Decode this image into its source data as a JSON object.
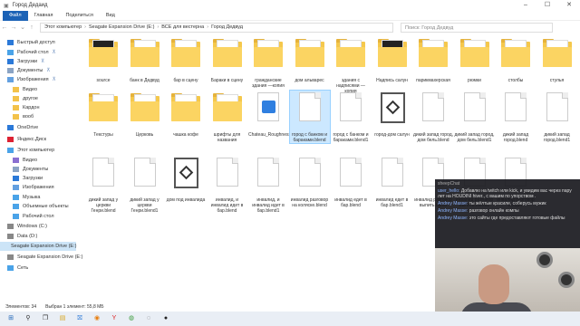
{
  "window": {
    "title": "Город Дедаид",
    "controls": [
      "–",
      "☐",
      "✕"
    ]
  },
  "ribbon": {
    "tabs": [
      "Файл",
      "Главная",
      "Поделиться",
      "Вид"
    ]
  },
  "address": {
    "crumbs": [
      "Этот компьютер",
      "Seagate Expansion Drive (E:)",
      "ВСЕ для вестерна",
      "Город Дедвуд"
    ],
    "search_placeholder": "Поиск: Город Дедвуд"
  },
  "sidebar": {
    "items": [
      {
        "label": "Быстрый доступ",
        "icon": "star-icon",
        "color": "#2b79d8"
      },
      {
        "label": "Рабочий стол",
        "icon": "desktop-icon",
        "color": "#4aa3e8",
        "pinned": true
      },
      {
        "label": "Загрузки",
        "icon": "download-icon",
        "color": "#2b79d8",
        "pinned": true
      },
      {
        "label": "Документы",
        "icon": "documents-icon",
        "color": "#8ba4c4",
        "pinned": true
      },
      {
        "label": "Изображения",
        "icon": "images-icon",
        "color": "#63a0e0",
        "pinned": true
      },
      {
        "label": "Видео",
        "icon": "folder-icon",
        "color": "#f3c24a"
      },
      {
        "label": "другое",
        "icon": "folder-icon",
        "color": "#f3c24a"
      },
      {
        "label": "Кардон",
        "icon": "folder-icon",
        "color": "#f3c24a"
      },
      {
        "label": "вооб",
        "icon": "folder-icon",
        "color": "#f3c24a"
      },
      {
        "label": "OneDrive",
        "icon": "cloud-icon",
        "color": "#2b79d8"
      },
      {
        "label": "Яндекс.Диск",
        "icon": "yandex-disk-icon",
        "color": "#d23"
      },
      {
        "label": "Этот компьютер",
        "icon": "computer-icon",
        "color": "#4aa3e8"
      },
      {
        "label": "Видео",
        "icon": "video-icon",
        "color": "#8a6fd1"
      },
      {
        "label": "Документы",
        "icon": "documents-icon",
        "color": "#8ba4c4"
      },
      {
        "label": "Загрузки",
        "icon": "download-icon",
        "color": "#2b79d8"
      },
      {
        "label": "Изображения",
        "icon": "images-icon",
        "color": "#63a0e0"
      },
      {
        "label": "Музыка",
        "icon": "music-icon",
        "color": "#4aa3e8"
      },
      {
        "label": "Объемные объекты",
        "icon": "3d-objects-icon",
        "color": "#4aa3e8"
      },
      {
        "label": "Рабочий стол",
        "icon": "desktop-icon",
        "color": "#4aa3e8"
      },
      {
        "label": "Windows (C:)",
        "icon": "drive-icon",
        "color": "#888"
      },
      {
        "label": "Data (D:)",
        "icon": "drive-icon",
        "color": "#888"
      },
      {
        "label": "Seagate Expansion Drive (E:)",
        "icon": "drive-icon",
        "color": "#888",
        "selected": true
      },
      {
        "label": "Seagate Expansion Drive (E:)",
        "icon": "drive-icon",
        "color": "#888"
      },
      {
        "label": "Сеть",
        "icon": "network-icon",
        "color": "#4aa3e8"
      }
    ]
  },
  "files": {
    "row1": [
      {
        "label": "source",
        "type": "folder-dark"
      },
      {
        "label": "банк в Дедвуд",
        "type": "folder"
      },
      {
        "label": "бар в сцену",
        "type": "folder"
      },
      {
        "label": "Бараки в сцену",
        "type": "folder"
      },
      {
        "label": "гражданские здания —копия",
        "type": "folder"
      },
      {
        "label": "дом альварес",
        "type": "folder"
      },
      {
        "label": "здания с надписями —копия",
        "type": "folder"
      },
      {
        "label": "Надпись салун",
        "type": "folder-dark"
      },
      {
        "label": "парикмахерская",
        "type": "folder"
      },
      {
        "label": "рюмки",
        "type": "folder"
      },
      {
        "label": "столбы",
        "type": "folder"
      },
      {
        "label": "стулья",
        "type": "folder"
      }
    ],
    "row2": [
      {
        "label": "Текстуры",
        "type": "folder"
      },
      {
        "label": "Церковь",
        "type": "folder"
      },
      {
        "label": "чашка кофе",
        "type": "folder"
      },
      {
        "label": "шрифты для названия",
        "type": "folder"
      },
      {
        "label": "Chateau_Roughness",
        "type": "image"
      },
      {
        "label": "город с банком и бараками.blend",
        "type": "doc",
        "selected": true
      },
      {
        "label": "город с банком и бараками.blend1",
        "type": "doc"
      },
      {
        "label": "город-дом салун",
        "type": "blend"
      },
      {
        "label": "дикий запад город, дом бель.blend",
        "type": "doc"
      },
      {
        "label": "дикий запад город, дом бель.blend1",
        "type": "doc"
      },
      {
        "label": "дикий запад город.blend",
        "type": "doc"
      },
      {
        "label": "дикий запад город.blend1",
        "type": "doc"
      }
    ],
    "row3": [
      {
        "label": "дикий запад у церкви Генри.blend",
        "type": "doc"
      },
      {
        "label": "дикий запад у церкви Генри.blend1",
        "type": "doc"
      },
      {
        "label": "дом под инвалида",
        "type": "blend"
      },
      {
        "label": "инвалид, и инвалид идет в бар.blend",
        "type": "doc"
      },
      {
        "label": "инвалид, и инвалид идет в бар.blend1",
        "type": "doc"
      },
      {
        "label": "инвалид разговор на коляске.blend",
        "type": "doc"
      },
      {
        "label": "инвалид едет в бар.blend",
        "type": "doc"
      },
      {
        "label": "инвалид едет в бар.blend1",
        "type": "doc"
      },
      {
        "label": "инвалид разговор выпить.blend",
        "type": "doc"
      },
      {
        "label": "инвалид разговор выпить.blend1",
        "type": "doc"
      },
      {
        "label": "инвалид разговор входит",
        "type": "doc"
      }
    ]
  },
  "status": {
    "count": "Элементов: 34",
    "selection": "Выбран 1 элемент: 55,8 МБ"
  },
  "chat": {
    "title": "sheepChat",
    "messages": [
      {
        "user": "user_hello:",
        "text": "Добавлю на twitch или kick, и увидим вас через пару лет на HOUDINI hiver., с вашим по упорством ."
      },
      {
        "user": "Andrey Masse:",
        "text": "ты жёлтые красиле, соберусь мужик"
      },
      {
        "user": "Andrey Masse:",
        "text": "разговор онлайн компы"
      },
      {
        "user": "Andrey Masse:",
        "text": "это сайты где предоставляют готовые файлы"
      }
    ]
  },
  "taskbar": {
    "icons": [
      "windows-start-icon",
      "search-icon",
      "task-view-icon",
      "explorer-icon",
      "store-icon",
      "blender-icon",
      "yandex-icon",
      "chrome-icon",
      "steam-icon",
      "obs-icon"
    ]
  }
}
